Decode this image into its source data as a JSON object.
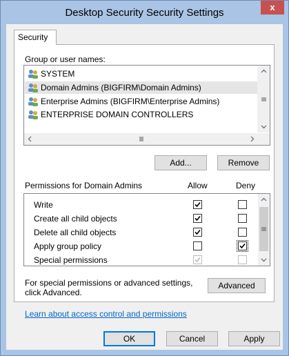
{
  "window": {
    "title": "Desktop Security Security Settings",
    "close_glyph": "x"
  },
  "tab": {
    "label": "Security"
  },
  "group_section": {
    "label": "Group or user names:",
    "users": [
      {
        "name": "SYSTEM",
        "selected": false
      },
      {
        "name": "Domain Admins (BIGFIRM\\Domain Admins)",
        "selected": true
      },
      {
        "name": "Enterprise Admins (BIGFIRM\\Enterprise Admins)",
        "selected": false
      },
      {
        "name": "ENTERPRISE DOMAIN CONTROLLERS",
        "selected": false
      }
    ],
    "add_label": "Add...",
    "remove_label": "Remove"
  },
  "permissions": {
    "header": "Permissions for Domain Admins",
    "allow_label": "Allow",
    "deny_label": "Deny",
    "rows": [
      {
        "name": "Write",
        "allow": true,
        "deny": false,
        "disabled": false
      },
      {
        "name": "Create all child objects",
        "allow": true,
        "deny": false,
        "disabled": false
      },
      {
        "name": "Delete all child objects",
        "allow": true,
        "deny": false,
        "disabled": false
      },
      {
        "name": "Apply group policy",
        "allow": false,
        "deny": true,
        "disabled": false
      },
      {
        "name": "Special permissions",
        "allow": true,
        "deny": false,
        "disabled": true
      }
    ]
  },
  "advanced": {
    "text_line1": "For special permissions or advanced settings,",
    "text_line2": "click Advanced.",
    "button_label": "Advanced"
  },
  "help_link": "Learn about access control and permissions",
  "footer": {
    "ok_label": "OK",
    "cancel_label": "Cancel",
    "apply_label": "Apply"
  },
  "colors": {
    "title_bg": "#a9c4e4",
    "close_bg": "#c75050",
    "selection_bg": "#e5e5e5",
    "link": "#0066cc"
  }
}
